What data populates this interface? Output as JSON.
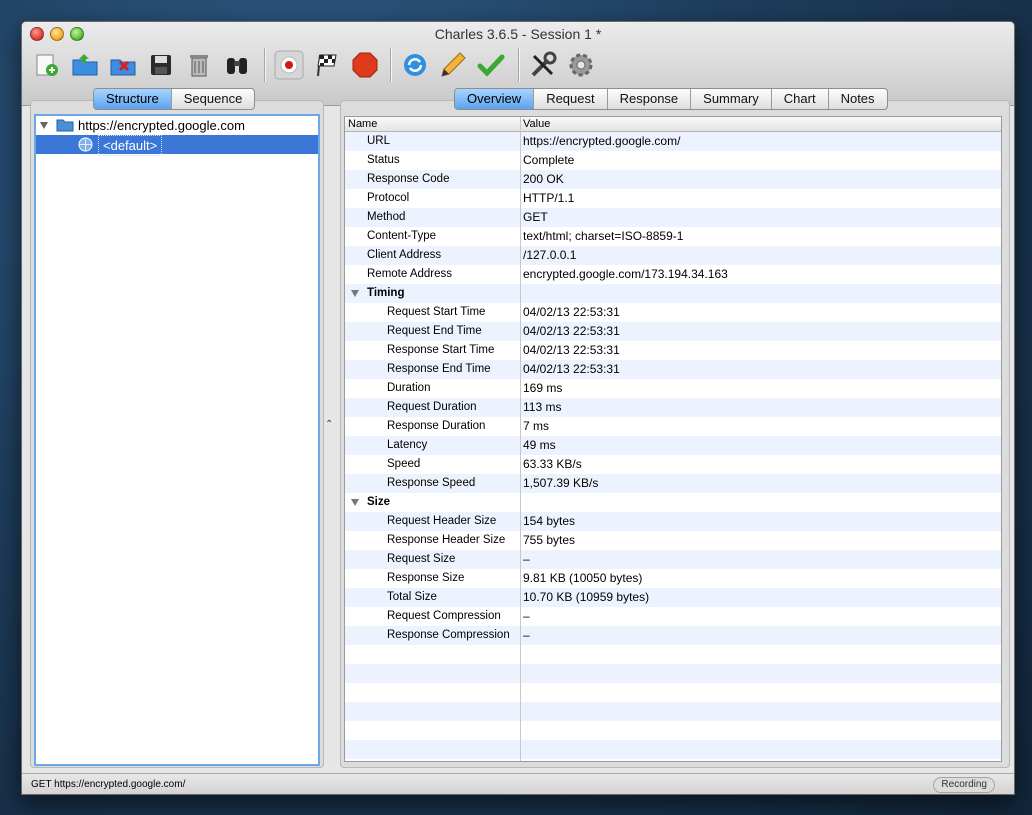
{
  "window": {
    "title": "Charles 3.6.5 - Session 1 *"
  },
  "toolbar": {
    "icons": [
      "new-session-icon",
      "open-session-icon",
      "close-session-icon",
      "save-icon",
      "clear-icon",
      "find-icon",
      "record-icon",
      "throttle-icon",
      "breakpoints-icon",
      "repeat-icon",
      "edit-icon",
      "validate-icon",
      "tools-icon",
      "settings-icon"
    ]
  },
  "left_tabs": {
    "structure": "Structure",
    "sequence": "Sequence"
  },
  "tree": {
    "host": "https://encrypted.google.com",
    "child": "<default>"
  },
  "right_tabs": {
    "overview": "Overview",
    "request": "Request",
    "response": "Response",
    "summary": "Summary",
    "chart": "Chart",
    "notes": "Notes"
  },
  "table": {
    "col_name": "Name",
    "col_value": "Value",
    "rows": [
      {
        "name": "URL",
        "value": "https://encrypted.google.com/"
      },
      {
        "name": "Status",
        "value": "Complete"
      },
      {
        "name": "Response Code",
        "value": "200 OK"
      },
      {
        "name": "Protocol",
        "value": "HTTP/1.1"
      },
      {
        "name": "Method",
        "value": "GET"
      },
      {
        "name": "Content-Type",
        "value": "text/html; charset=ISO-8859-1"
      },
      {
        "name": "Client Address",
        "value": "/127.0.0.1"
      },
      {
        "name": "Remote Address",
        "value": "encrypted.google.com/173.194.34.163"
      }
    ],
    "timing_label": "Timing",
    "timing": [
      {
        "name": "Request Start Time",
        "value": "04/02/13 22:53:31"
      },
      {
        "name": "Request End Time",
        "value": "04/02/13 22:53:31"
      },
      {
        "name": "Response Start Time",
        "value": "04/02/13 22:53:31"
      },
      {
        "name": "Response End Time",
        "value": "04/02/13 22:53:31"
      },
      {
        "name": "Duration",
        "value": "169 ms"
      },
      {
        "name": "Request Duration",
        "value": "113 ms"
      },
      {
        "name": "Response Duration",
        "value": "7 ms"
      },
      {
        "name": "Latency",
        "value": "49 ms"
      },
      {
        "name": "Speed",
        "value": "63.33 KB/s"
      },
      {
        "name": "Response Speed",
        "value": "1,507.39 KB/s"
      }
    ],
    "size_label": "Size",
    "size": [
      {
        "name": "Request Header Size",
        "value": "154 bytes"
      },
      {
        "name": "Response Header Size",
        "value": "755 bytes"
      },
      {
        "name": "Request Size",
        "value": "–"
      },
      {
        "name": "Response Size",
        "value": "9.81 KB (10050 bytes)"
      },
      {
        "name": "Total Size",
        "value": "10.70 KB (10959 bytes)"
      },
      {
        "name": "Request Compression",
        "value": "–"
      },
      {
        "name": "Response Compression",
        "value": "–"
      }
    ]
  },
  "statusbar": {
    "left": "GET https://encrypted.google.com/",
    "right": "Recording"
  }
}
